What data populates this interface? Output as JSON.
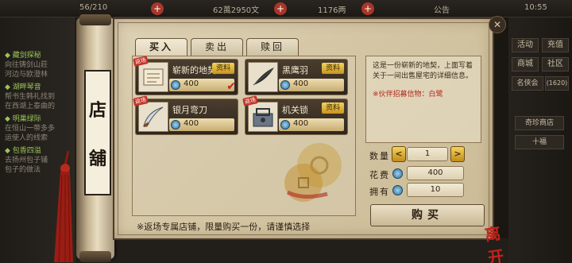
{
  "topbar": {
    "stamina": "56/210",
    "gold": "62萬2950文",
    "wine": "1176两",
    "notice": "公告",
    "time": "10:55"
  },
  "quests": [
    {
      "title": "◆ 藏剑探秘",
      "desc": "向往铸剑山莊"
    },
    {
      "title": "",
      "desc": "河边与欧澄林"
    },
    {
      "title": "◆ 湖畔琴音",
      "desc": "帮书生韩礼找到"
    },
    {
      "title": "",
      "desc": "在西湖上泰曲的"
    },
    {
      "title": "◆ 明巢绿际",
      "desc": "在恒山一带多多"
    },
    {
      "title": "",
      "desc": "运使人的线索"
    },
    {
      "title": "◆ 包香四溢",
      "desc": "去扬州包子铺"
    },
    {
      "title": "",
      "desc": "包子的做法"
    }
  ],
  "side_buttons": [
    {
      "label": "活动"
    },
    {
      "label": "充值"
    },
    {
      "label": "商城"
    },
    {
      "label": "社区"
    },
    {
      "label": "名侠会"
    },
    {
      "label": "(1620)"
    },
    {
      "label": "奇珍商店"
    },
    {
      "label": "十福"
    }
  ],
  "shop": {
    "sign_chars": [
      "店",
      "舖"
    ],
    "tabs": [
      {
        "label": "买入",
        "active": true
      },
      {
        "label": "卖出",
        "active": false
      },
      {
        "label": "赎回",
        "active": false
      }
    ],
    "items": [
      {
        "name": "崭新的地契",
        "badge": "资料",
        "price": "400",
        "selected": true,
        "sticker": "返场"
      },
      {
        "name": "黑鹰羽",
        "badge": "资料",
        "price": "400",
        "selected": false,
        "sticker": ""
      },
      {
        "name": "银月弯刀",
        "badge": "资料",
        "price": "400",
        "selected": false,
        "sticker": "返场"
      },
      {
        "name": "机关锁",
        "badge": "资料",
        "price": "400",
        "selected": false,
        "sticker": "返场"
      }
    ],
    "detail": {
      "description": "这是一份崭新的地契，上面写着关于一间出售屋宅的详细信息。",
      "note": "※伙伴招募信物：白鹭"
    },
    "quantity_label": "数量",
    "quantity_value": "1",
    "cost_label": "花费",
    "cost_value": "400",
    "owned_label": "拥有",
    "owned_value": "10",
    "buy_label": "购买",
    "footer_note": "※返场专属店铺，限量购买一份，请谨慎选择",
    "exit_label": "离开"
  },
  "colors": {
    "parchment": "#d4c6a4",
    "card_dark": "#3a2e22",
    "badge_gold": "#e3b83e",
    "accent_red": "#c2231a",
    "coin_blue": "#2e6d98"
  }
}
